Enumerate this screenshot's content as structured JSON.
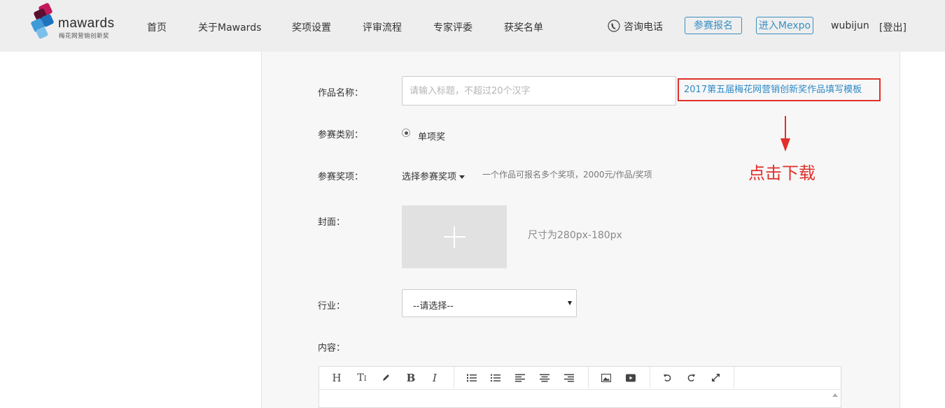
{
  "header": {
    "logo_text": "mawards",
    "logo_subtitle": "梅花网营销创新奖",
    "nav": [
      {
        "label": "首页"
      },
      {
        "label": "关于Mawards"
      },
      {
        "label": "奖项设置"
      },
      {
        "label": "评审流程"
      },
      {
        "label": "专家评委"
      },
      {
        "label": "获奖名单"
      }
    ],
    "phone_label": "咨询电话",
    "register_button": "参赛报名",
    "mexpo_button": "进入Mexpo",
    "username": "wubijun",
    "logout": "[登出]"
  },
  "form": {
    "title_label": "作品名称：",
    "title_placeholder": "请输入标题，不超过20个汉字",
    "template_link": "2017第五届梅花网营销创新奖作品填写模板",
    "category_label": "参赛类别：",
    "category_option": "单项奖",
    "award_label": "参赛奖项：",
    "award_select": "选择参赛奖项",
    "award_hint": "一个作品可报名多个奖项，2000元/作品/奖项",
    "cover_label": "封面：",
    "cover_hint": "尺寸为280px-180px",
    "industry_label": "行业：",
    "industry_value": "--请选择--",
    "content_label": "内容："
  },
  "annotation": {
    "text": "点击下载",
    "color": "#e0302b"
  },
  "editor_toolbar": [
    "heading-icon",
    "text-size-icon",
    "pen-icon",
    "bold-icon",
    "italic-icon",
    "ordered-list-icon",
    "unordered-list-icon",
    "align-left-icon",
    "align-center-icon",
    "align-right-icon",
    "image-icon",
    "video-icon",
    "undo-icon",
    "redo-icon",
    "fullscreen-icon"
  ],
  "colors": {
    "accent": "#3a8fc2",
    "link": "#2d8ac7",
    "highlight_border": "#e0302b"
  }
}
